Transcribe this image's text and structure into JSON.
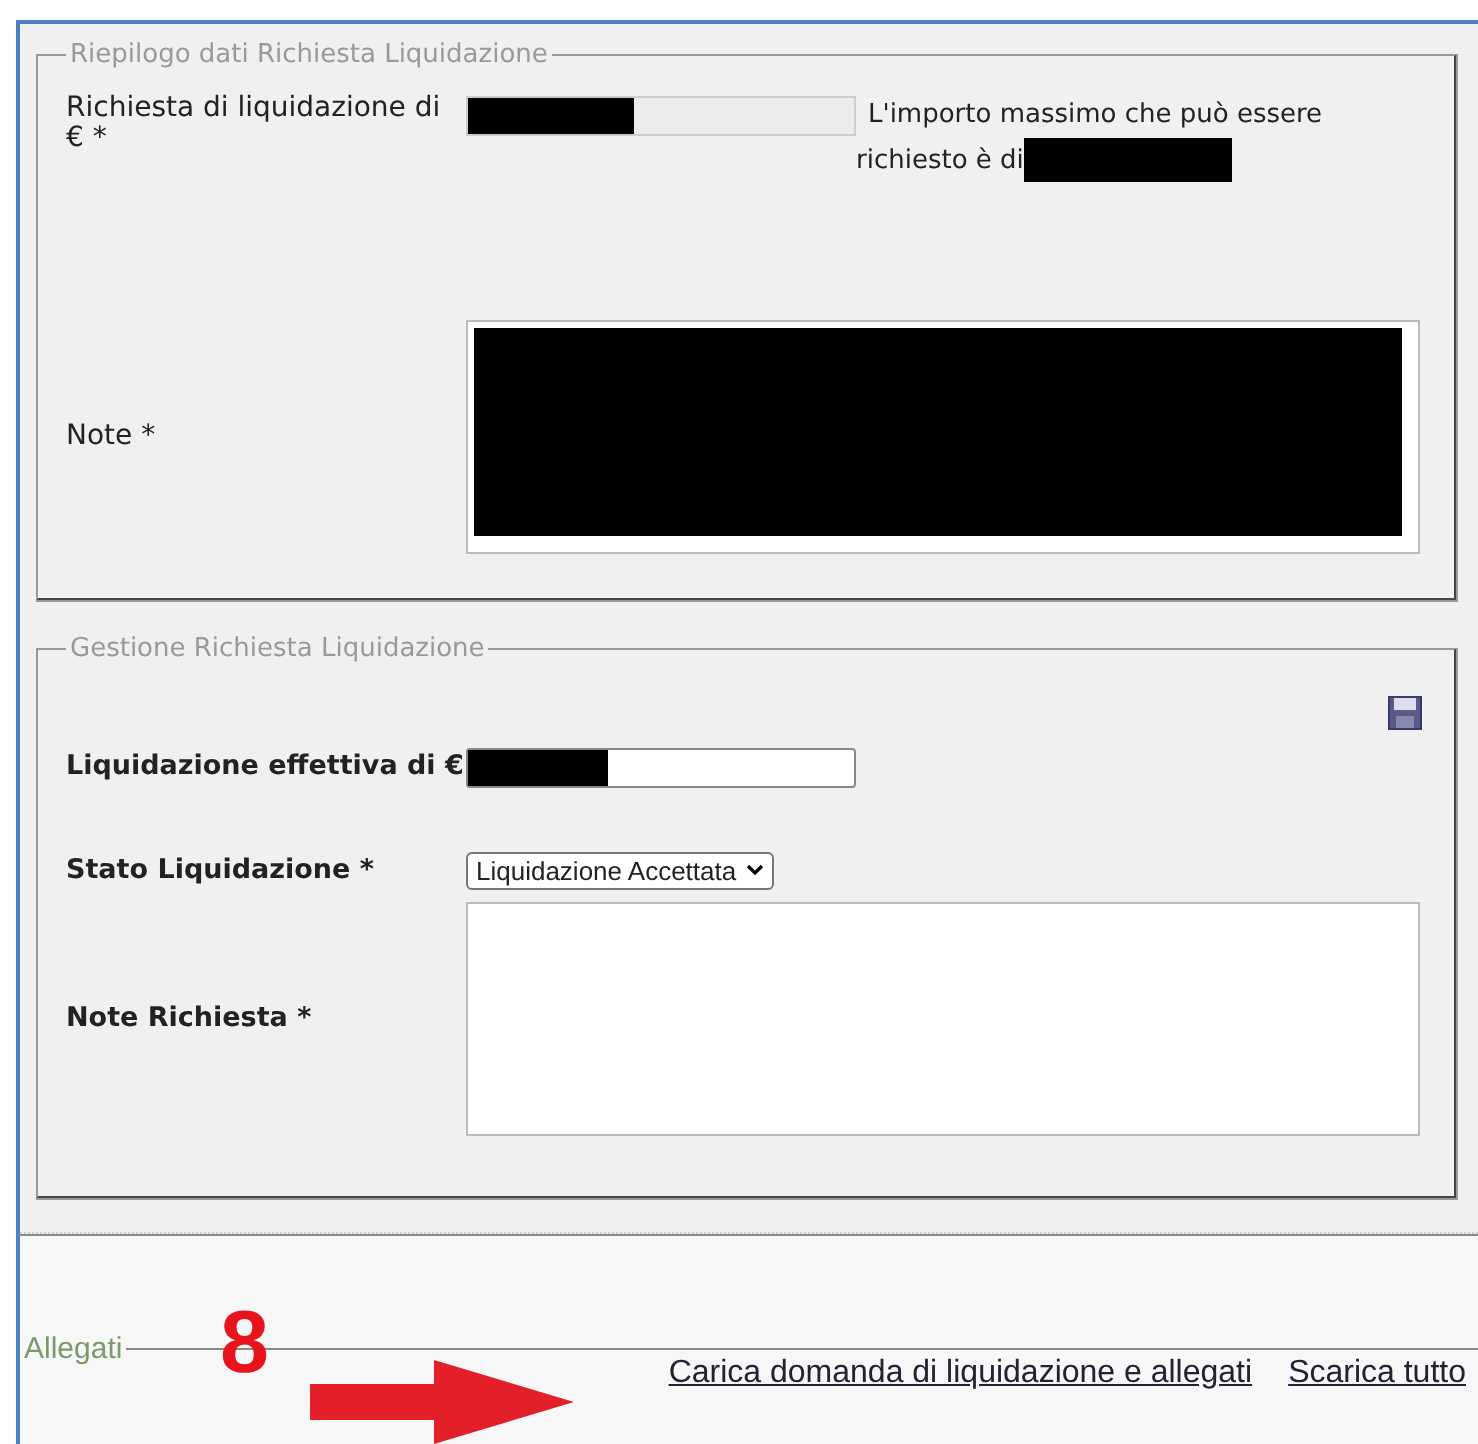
{
  "sections": [
    {
      "legend": "Riepilogo dati Richiesta Liquidazione",
      "bold_labels": false,
      "fields": [
        {
          "kind": "amount",
          "label": "Richiesta di liquidazione di € *",
          "redacted": true,
          "note": "L'importo massimo che può essere richiesto è di",
          "note_redacted": true
        },
        {
          "kind": "textarea",
          "label": "Note *",
          "redacted": true
        }
      ]
    },
    {
      "legend": "Gestione Richiesta Liquidazione",
      "bold_labels": true,
      "save_icon": true,
      "fields": [
        {
          "kind": "amount",
          "label": "Liquidazione effettiva di €",
          "redacted": true
        },
        {
          "kind": "select",
          "label": "Stato Liquidazione *",
          "value": "Liquidazione Accettata"
        },
        {
          "kind": "textarea",
          "label": "Note Richiesta *",
          "redacted": false
        }
      ]
    }
  ],
  "attachments": {
    "legend": "Allegati",
    "links": [
      "Carica domanda di liquidazione e allegati",
      "Scarica tutto"
    ]
  },
  "annotation": {
    "number": "8"
  }
}
